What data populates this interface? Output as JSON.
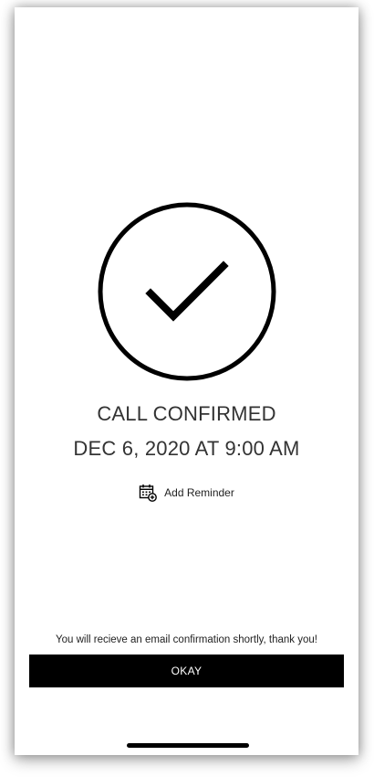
{
  "confirmation": {
    "status_icon": "check-circle-icon",
    "title": "CALL CONFIRMED",
    "datetime": "DEC 6, 2020 AT 9:00 AM"
  },
  "reminder": {
    "icon": "calendar-add-icon",
    "label": "Add Reminder"
  },
  "footer": {
    "note": "You will recieve an email confirmation shortly, thank you!",
    "okay_label": "OKAY"
  },
  "colors": {
    "primary": "#000000",
    "text": "#333333",
    "background": "#ffffff"
  }
}
